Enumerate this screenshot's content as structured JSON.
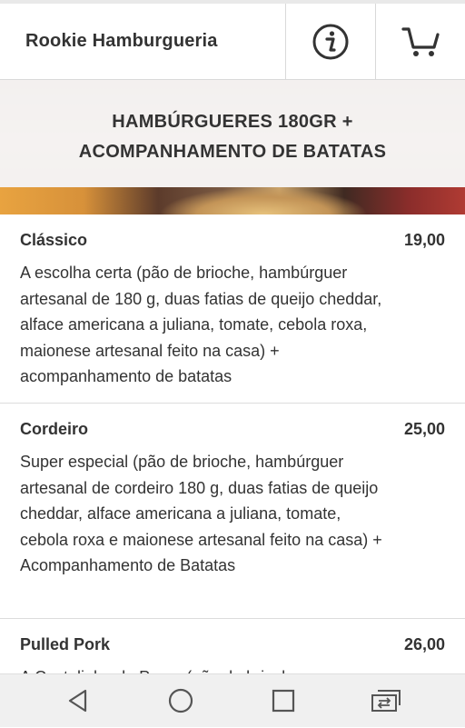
{
  "header": {
    "title": "Rookie Hamburgueria",
    "info_icon": "info-icon",
    "cart_icon": "cart-icon"
  },
  "category": {
    "title_line1": "HAMBÚRGUERES 180GR +",
    "title_line2": "ACOMPANHAMENTO DE BATATAS"
  },
  "items": [
    {
      "name": "Clássico",
      "price": "19,00",
      "description": "A escolha certa (pão de brioche, hambúrguer artesanal de 180 g, duas fatias de queijo cheddar, alface americana a juliana, tomate, cebola roxa, maionese artesanal feito na casa) + acompanhamento de batatas"
    },
    {
      "name": "Cordeiro",
      "price": "25,00",
      "description": "Super especial (pão de brioche, hambúrguer artesanal de cordeiro 180 g, duas fatias de queijo cheddar, alface americana a juliana, tomate, cebola roxa e maionese artesanal feito na casa) + Acompanhamento de Batatas"
    },
    {
      "name": "Pulled Pork",
      "price": "26,00",
      "description": "A Costelinha de Porco (pão de brioche"
    }
  ],
  "navbar": {
    "icons": [
      "back-icon",
      "home-icon",
      "recents-icon",
      "switch-icon"
    ]
  }
}
